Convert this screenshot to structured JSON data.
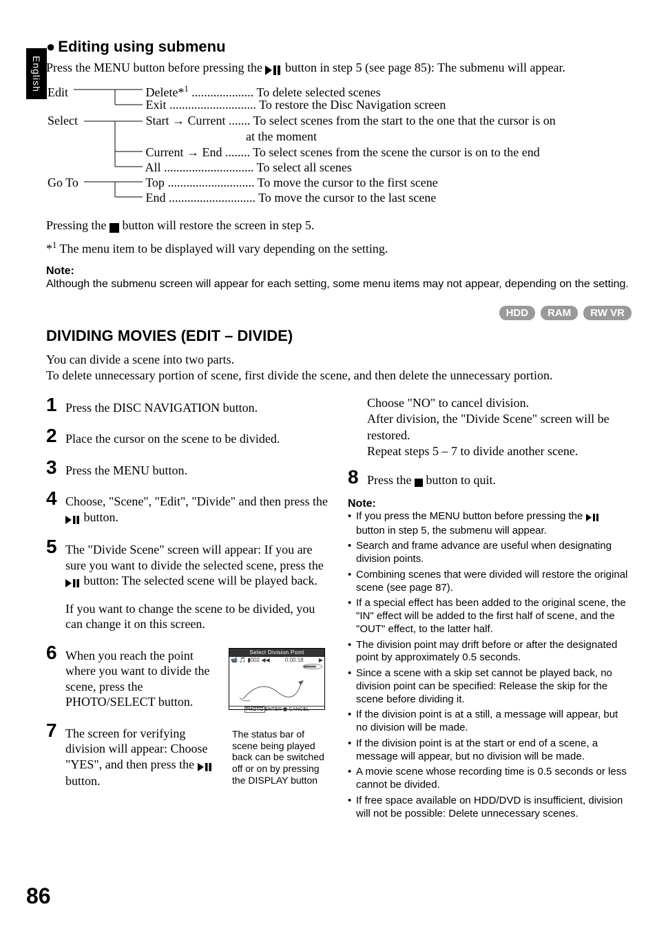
{
  "side_tab": "English",
  "section1": {
    "heading": "Editing using submenu",
    "intro_before_icon": "Press the MENU button before pressing the ",
    "intro_after_icon": " button in step 5 (see page 85): The submenu will appear.",
    "tree": {
      "edit": {
        "root": "Edit",
        "items": [
          {
            "label": "Delete*¹",
            "desc": "To delete selected scenes"
          },
          {
            "label": "Exit",
            "desc": "To restore the Disc Navigation screen"
          }
        ]
      },
      "select": {
        "root": "Select",
        "items": [
          {
            "label": "Start → Current",
            "desc": "To select scenes from the start to the one that the cursor is on at the moment"
          },
          {
            "label": "Current → End",
            "desc": "To select scenes from the scene the cursor is on to the end"
          },
          {
            "label": "All",
            "desc": "To select all scenes"
          }
        ]
      },
      "goto": {
        "root": "Go To",
        "items": [
          {
            "label": "Top",
            "desc": "To move the cursor to the first scene"
          },
          {
            "label": "End",
            "desc": "To move the cursor to the last scene"
          }
        ]
      }
    },
    "after_tree_before_icon": "Pressing the ",
    "after_tree_after_icon": " button will restore the screen in step 5.",
    "footnote": "*¹ The menu item to be displayed will vary depending on the setting.",
    "note_heading": "Note:",
    "note_body": "Although the submenu screen will appear for each setting, some menu items may not appear, depending on the setting."
  },
  "badges": [
    "HDD",
    "RAM",
    "RW VR"
  ],
  "section2": {
    "heading": "DIVIDING MOVIES (EDIT – DIVIDE)",
    "intro": "You can divide a scene into two parts.\nTo delete unnecessary portion of scene, first divide the scene, and then delete the unnecessary portion.",
    "steps": [
      "Press the DISC NAVIGATION button.",
      "Place the cursor on the scene to be divided.",
      "Press the MENU button.",
      "Choose, \"Scene\", \"Edit\", \"Divide\" and then press the ▶/▮▮ button.",
      "The \"Divide Scene\" screen will appear: If you are sure you want to divide the selected scene, press the ▶/▮▮ button: The selected scene will be played back.",
      "When you reach the point where you want to divide the scene, press the PHOTO/SELECT button.",
      "The screen for verifying division will appear: Choose \"YES\", and then press the ▶/▮▮ button.",
      "Press the ■ button to quit."
    ],
    "step5_extra": "If you want to change the scene to be divided, you can change it on this screen.",
    "figure": {
      "title": "Select Division Point",
      "counter": "002",
      "timecode": "0:00:18",
      "bottom": "PHOTO ENTER ■ CANCEL",
      "caption": "The status bar of scene being played back can be switched off or on by pressing the DISPLAY button"
    },
    "right_top": {
      "lines": [
        "Choose \"NO\" to cancel division.",
        "After division, the \"Divide Scene\" screen will be restored.",
        "Repeat steps 5 – 7 to divide another scene."
      ]
    },
    "note_heading": "Note:",
    "notes": [
      "If you press the MENU button before pressing the ▶/▮▮ button in step 5, the submenu will appear.",
      "Search and frame advance are useful when designating division points.",
      "Combining scenes that were divided will restore the original scene (see page 87).",
      "If a special effect has been added to the original scene, the \"IN\" effect will be added to the first half of scene, and the \"OUT\" effect, to the latter half.",
      "The division point may drift before or after the designated point by approximately 0.5 seconds.",
      "Since a scene with a skip set cannot be played back, no division point can be specified: Release the skip for the scene before dividing it.",
      "If the division point is at a still, a message will appear, but no division will be made.",
      "If the division point is at the start or end of a scene, a message will appear, but no division will be made.",
      "A movie scene whose recording time is 0.5 seconds or less cannot be divided.",
      "If free space available on HDD/DVD is insufficient, division will not be possible: Delete unnecessary scenes."
    ]
  },
  "page_number": "86"
}
